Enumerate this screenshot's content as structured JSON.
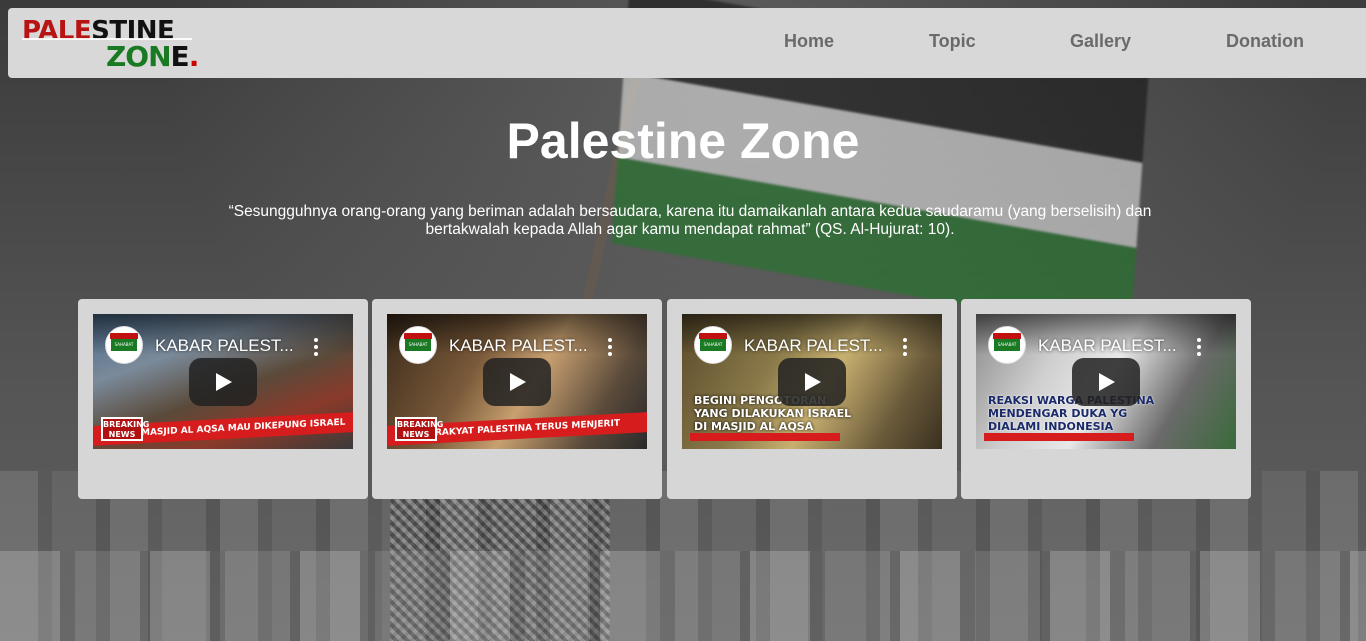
{
  "logo": {
    "top_red": "PALE",
    "top_black": "STINE",
    "bottom_green": "ZON",
    "bottom_black": "E",
    "bottom_dot": "."
  },
  "nav": {
    "items": [
      {
        "label": "Home"
      },
      {
        "label": "Topic"
      },
      {
        "label": "Gallery"
      },
      {
        "label": "Donation"
      }
    ]
  },
  "hero": {
    "title": "Palestine Zone",
    "quote": "“Sesungguhnya orang-orang yang beriman adalah bersaudara, karena itu damaikanlah antara kedua saudaramu (yang berselisih) dan bertakwalah kepada Allah agar kamu mendapat rahmat” (QS. Al-Hujurat: 10)."
  },
  "videos": [
    {
      "title": "KABAR PALEST...",
      "news_badge": "BREAKING NEWS",
      "banner": "MASJID AL AQSA MAU DIKEPUNG ISRAEL"
    },
    {
      "title": "KABAR PALEST...",
      "news_badge": "BREAKING NEWS",
      "banner": "RAKYAT PALESTINA TERUS MENJERIT"
    },
    {
      "title": "KABAR PALEST...",
      "news_badge": "",
      "banner": "BEGINI PENGOTORAN YANG DILAKUKAN ISRAEL DI MASJID AL AQSA"
    },
    {
      "title": "KABAR PALEST...",
      "news_badge": "",
      "banner": "REAKSI WARGA PALESTINA MENDENGAR DUKA YG DIALAMI INDONESIA"
    }
  ],
  "channel": {
    "avatar_text": "SAHABAT PALESTINA"
  },
  "colors": {
    "navbar_bg": "#d8d8d8",
    "nav_text": "#6a6a6a",
    "card_bg": "#d6d6d6",
    "logo_red": "#b81414",
    "logo_green": "#1a7a23",
    "play_button": "#212121"
  },
  "icons": {
    "play": "play-icon",
    "more": "more-vert-icon"
  }
}
